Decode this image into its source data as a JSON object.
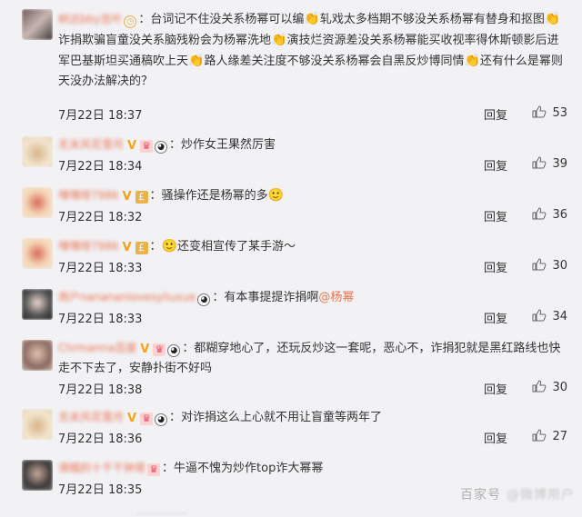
{
  "comments": [
    {
      "name": "树达bby吉叶",
      "text_parts": [
        "台词记不住没关系杨幂可以编",
        "轧戏太多档期不够没关系杨幂有替身和抠图",
        "诈捐欺骗盲童没关系脑残粉会为杨幂洗地",
        "演技烂资源差没关系杨幂能买收视率得休斯顿影后进军巴基斯坦买通稿吹上天",
        "路人缘差关注度不够没关系杨幂会自黑反炒博同情",
        "还有什么是幂则天没办法解决的？"
      ],
      "time": "7月22日 18:37",
      "reply": "回复",
      "likes": "53"
    },
    {
      "name": "无关风花雪月",
      "text": "炒作女王果然厉害",
      "time": "7月22日 18:34",
      "reply": "回复",
      "likes": "39"
    },
    {
      "name": "嘿嘿呀7986",
      "text": "骚操作还是杨幂的多",
      "time": "7月22日 18:32",
      "reply": "回复",
      "likes": "36"
    },
    {
      "name": "嘿嘿呀7986",
      "text": "还变相宣传了某手游～",
      "time": "7月22日 18:33",
      "reply": "回复",
      "likes": "30"
    },
    {
      "name": "用户nanananlovesyliuxue",
      "text": "有本事提提诈捐啊",
      "mention": "@杨幂",
      "time": "7月22日 18:33",
      "reply": "回复",
      "likes": "34"
    },
    {
      "name": "Chrmanna百度",
      "text": "都糊穿地心了，还玩反炒这一套呢，恶心不，诈捐犯就是黑红路线也快走不下去了，安静扑街不好吗",
      "time": "7月22日 18:38",
      "reply": "回复",
      "likes": "30"
    },
    {
      "name": "无关风花雪月",
      "text": "对诈捐这么上心就不用让盲童等两年了",
      "time": "7月22日 18:36",
      "reply": "回复",
      "likes": "27"
    },
    {
      "name": "滑稽的十千千钟哥",
      "text": "牛逼不愧为炒作top诈大幂幂",
      "time": "7月22日 18:35",
      "reply": "回复",
      "likes": ""
    }
  ],
  "watermark": {
    "brand": "百家号",
    "weibo": "@微博用户"
  },
  "cut_text": "……………"
}
